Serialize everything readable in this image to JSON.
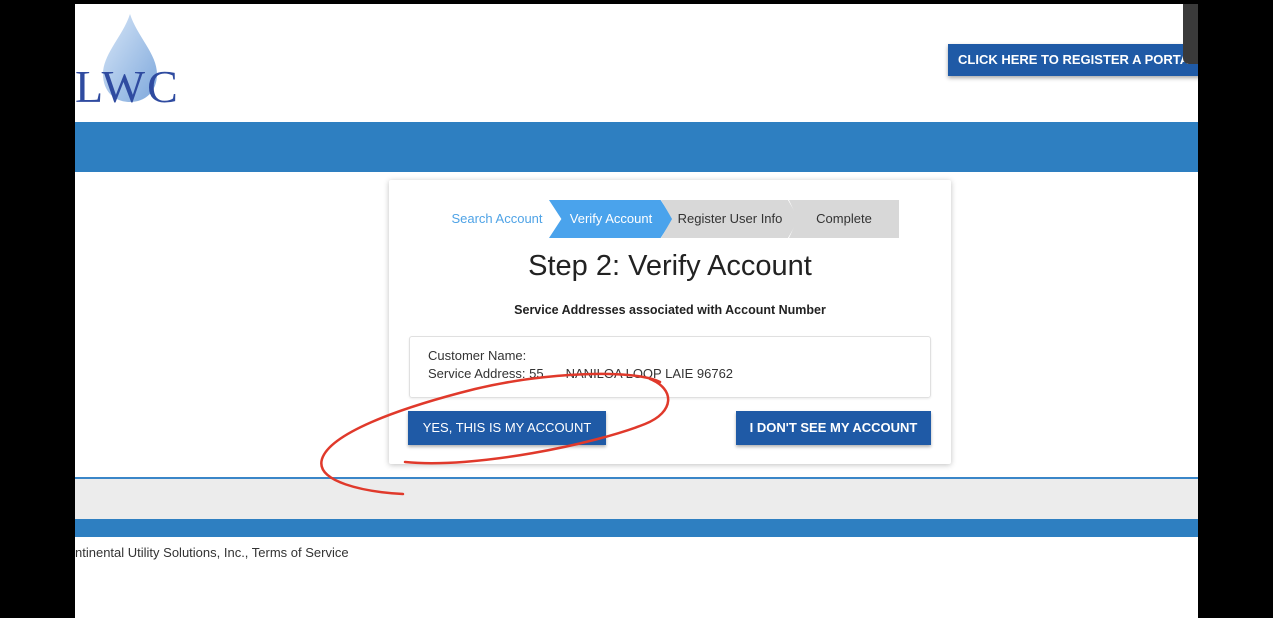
{
  "logo": {
    "text": "LWC"
  },
  "header": {
    "register_button": "CLICK HERE TO REGISTER A PORTA"
  },
  "wizard": {
    "steps": [
      {
        "label": "Search Account"
      },
      {
        "label": "Verify Account"
      },
      {
        "label": "Register User Info"
      },
      {
        "label": "Complete"
      }
    ],
    "title": "Step 2: Verify Account",
    "subtitle": "Service Addresses associated with Account Number",
    "customer_name_label": "Customer Name:",
    "service_address_label": "Service Address: 55",
    "service_address_value": "NANILOA LOOP LAIE 96762",
    "yes_button": "YES, THIS IS MY ACCOUNT",
    "no_button": "I DON'T SEE MY ACCOUNT"
  },
  "footer": {
    "text": "ntinental Utility Solutions, Inc.,   Terms of Service"
  },
  "colors": {
    "primary_button": "#1f5aa6",
    "band_blue": "#2e7fc1",
    "active_step": "#4aa3ec",
    "annotation_red": "#e0392b"
  }
}
